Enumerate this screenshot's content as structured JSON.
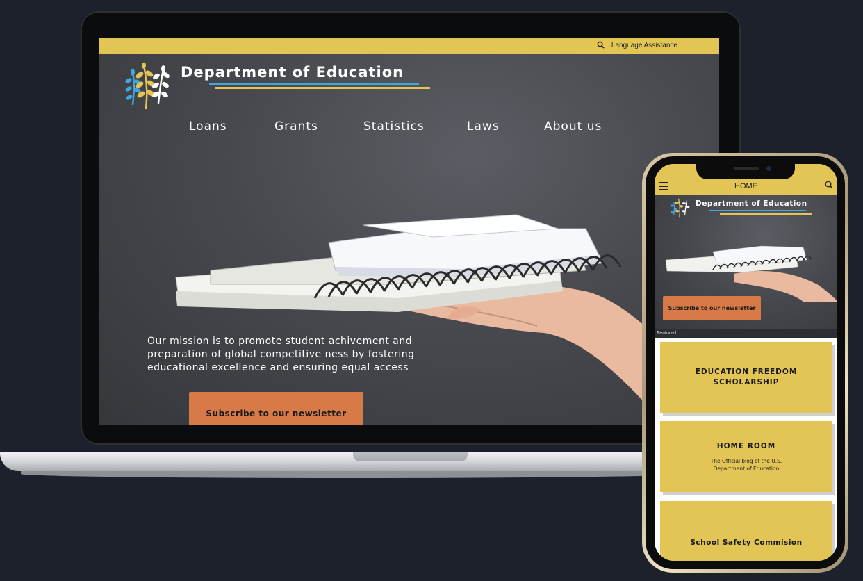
{
  "desktop": {
    "topbar": {
      "language_label": "Language Assistance",
      "search_icon": "search-icon"
    },
    "brand": {
      "title": "Department of Education",
      "logo_icon": "leaf-sprigs-icon"
    },
    "nav": [
      {
        "label": "Loans"
      },
      {
        "label": "Grants"
      },
      {
        "label": "Statistics"
      },
      {
        "label": "Laws"
      },
      {
        "label": "About us"
      }
    ],
    "hero": {
      "mission": "Our mission is to promote student achivement and preparation of global competitive ness by fostering educational excellence and ensuring equal access",
      "subscribe_label": "Subscribe to our newsletter"
    }
  },
  "mobile": {
    "appbar": {
      "title": "HOME",
      "menu_icon": "hamburger-menu-icon",
      "search_icon": "search-icon"
    },
    "brand": {
      "title": "Department of Education"
    },
    "hero": {
      "subscribe_label": "Subscribe to our newsletter"
    },
    "featured_label": "Featured",
    "cards": [
      {
        "title": "EDUCATION FREEDOM SCHOLARSHIP",
        "subtitle": ""
      },
      {
        "title": "HOME ROOM",
        "subtitle": "The Official blog of the U.S. Department of Education"
      },
      {
        "title": "School Safety Commision",
        "subtitle": ""
      }
    ]
  },
  "colors": {
    "background": "#1d212c",
    "accent_yellow": "#e3c556",
    "accent_orange": "#d77a48",
    "accent_blue": "#3fa6e0",
    "hero_gray": "#47494e"
  }
}
